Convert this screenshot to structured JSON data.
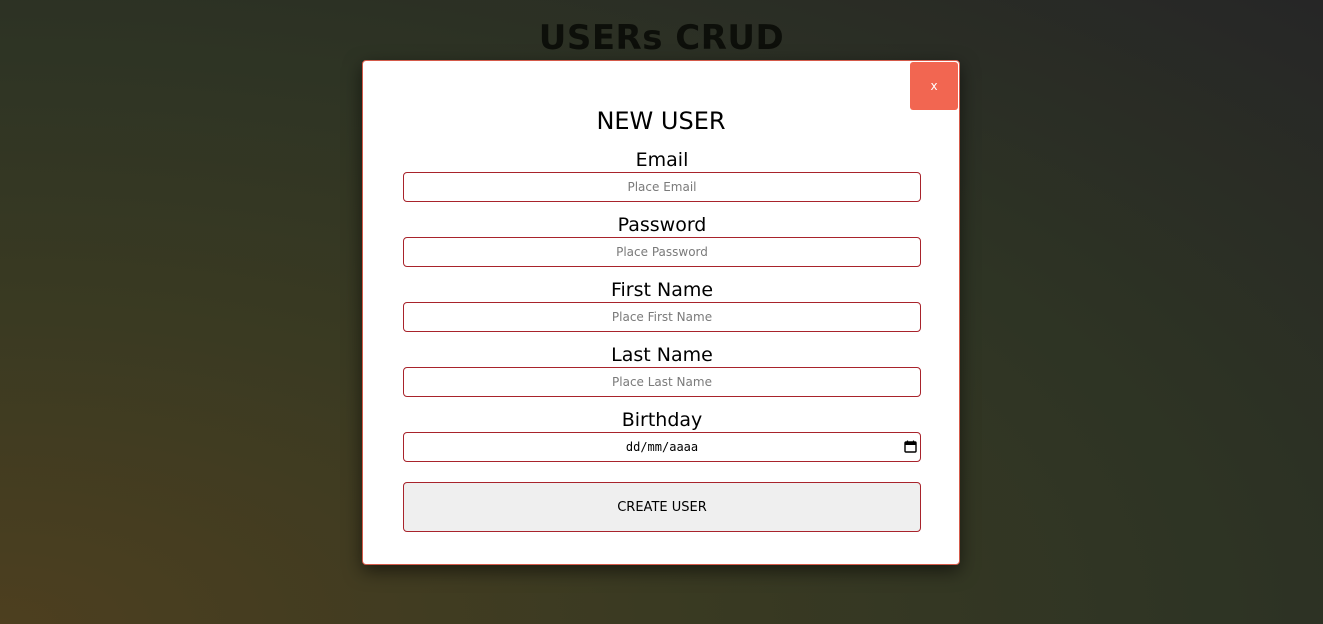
{
  "page": {
    "title": "USERs CRUD"
  },
  "modal": {
    "close_label": "x",
    "title": "NEW USER",
    "fields": [
      {
        "label": "Email",
        "placeholder": "Place Email",
        "type": "email"
      },
      {
        "label": "Password",
        "placeholder": "Place Password",
        "type": "password"
      },
      {
        "label": "First Name",
        "placeholder": "Place First Name",
        "type": "text"
      },
      {
        "label": "Last Name",
        "placeholder": "Place Last Name",
        "type": "text"
      }
    ],
    "birthday": {
      "label": "Birthday",
      "placeholder": "dd/mm/aaaa",
      "icon": "calendar-icon"
    },
    "submit_label": "CREATE USER"
  },
  "colors": {
    "close_button": "#f26651",
    "input_border": "#a8232b",
    "submit_background": "#efefef"
  }
}
